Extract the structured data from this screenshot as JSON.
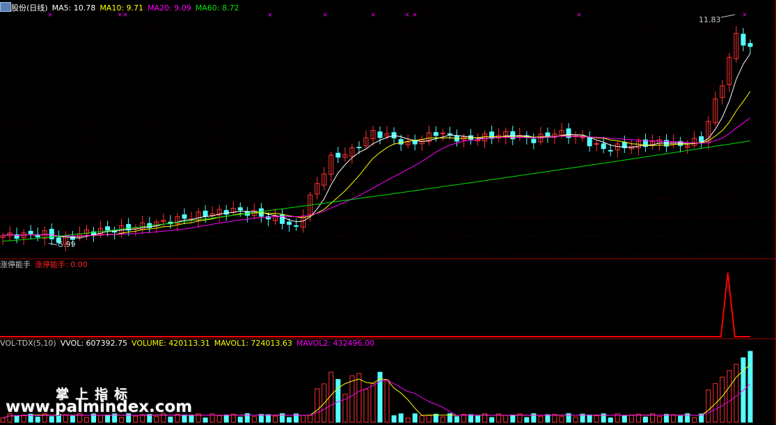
{
  "header": {
    "stock_name": "股份(日线)",
    "ma5": "MA5: 10.78",
    "ma10": "MA10: 9.71",
    "ma20": "MA20: 9.09",
    "ma60": "MA60: 8.72"
  },
  "indicator": {
    "name": "涨停能手",
    "value_label": "涨停能手: 0.00"
  },
  "volume_header": {
    "name": "VOL-TDX(5,10)",
    "vvol": "VVOL: 607392.75",
    "volume": "VOLUME: 420113.31",
    "mavol1": "MAVOL1: 724013.63",
    "mavol2": "MAVOL2: 432496.00"
  },
  "annotations": {
    "high": "11.83",
    "low": "5.99"
  },
  "watermark": {
    "cn": "掌上指标",
    "url": "www.palmindex.com"
  },
  "colors": {
    "up": "#ff3232",
    "down": "#54ffff",
    "ma5": "#ffffff",
    "ma10": "#ffff00",
    "ma20": "#ff00ff",
    "ma60": "#00e400",
    "indicator": "#ff0000",
    "divider": "#a00000",
    "grid": "#a00000"
  },
  "chart_data": {
    "type": "candlestick",
    "price_range": [
      5.6,
      12.2
    ],
    "high": 11.83,
    "low": 5.99,
    "indicator_spike_at": 0.97,
    "indicator_spike_value": 1.0,
    "ma5_last": 10.78,
    "ma10_last": 9.71,
    "ma20_last": 9.09,
    "ma60_last": 8.72,
    "vvol_last": 607392.75,
    "volume_last": 420113.31,
    "mavol1_last": 724013.63,
    "mavol2_last": 432496.0
  }
}
